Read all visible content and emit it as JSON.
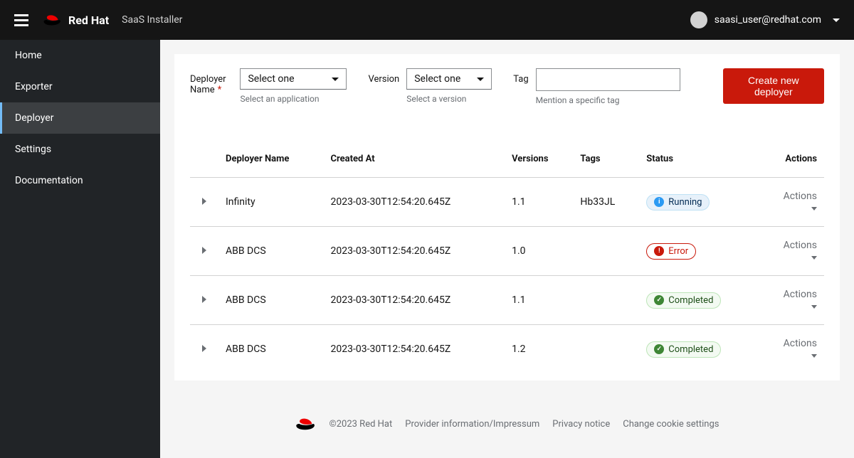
{
  "header": {
    "brand": "Red Hat",
    "app_title": "SaaS Installer",
    "user_email": "saasi_user@redhat.com"
  },
  "sidebar": {
    "items": [
      {
        "label": "Home",
        "active": false
      },
      {
        "label": "Exporter",
        "active": false
      },
      {
        "label": "Deployer",
        "active": true
      },
      {
        "label": "Settings",
        "active": false
      },
      {
        "label": "Documentation",
        "active": false
      }
    ]
  },
  "filters": {
    "deployer_name": {
      "label": "Deployer Name",
      "required": true,
      "value": "Select one",
      "helper": "Select an application"
    },
    "version": {
      "label": "Version",
      "value": "Select one",
      "helper": "Select a version"
    },
    "tag": {
      "label": "Tag",
      "value": "",
      "helper": "Mention a specific tag"
    },
    "create_button": "Create new deployer"
  },
  "table": {
    "columns": [
      "Deployer Name",
      "Created At",
      "Versions",
      "Tags",
      "Status",
      "Actions"
    ],
    "rows": [
      {
        "name": "Infinity",
        "created_at": "2023-03-30T12:54:20.645Z",
        "versions": "1.1",
        "tags": "Hb33JL",
        "status": "Running",
        "status_kind": "running",
        "actions": "Actions"
      },
      {
        "name": "ABB DCS",
        "created_at": "2023-03-30T12:54:20.645Z",
        "versions": "1.0",
        "tags": "",
        "status": "Error",
        "status_kind": "error",
        "actions": "Actions"
      },
      {
        "name": "ABB DCS",
        "created_at": "2023-03-30T12:54:20.645Z",
        "versions": "1.1",
        "tags": "",
        "status": "Completed",
        "status_kind": "completed",
        "actions": "Actions"
      },
      {
        "name": "ABB DCS",
        "created_at": "2023-03-30T12:54:20.645Z",
        "versions": "1.2",
        "tags": "",
        "status": "Completed",
        "status_kind": "completed",
        "actions": "Actions"
      }
    ]
  },
  "footer": {
    "copyright": "©2023 Red Hat",
    "links": [
      "Provider information/Impressum",
      "Privacy notice",
      "Change cookie settings"
    ]
  }
}
